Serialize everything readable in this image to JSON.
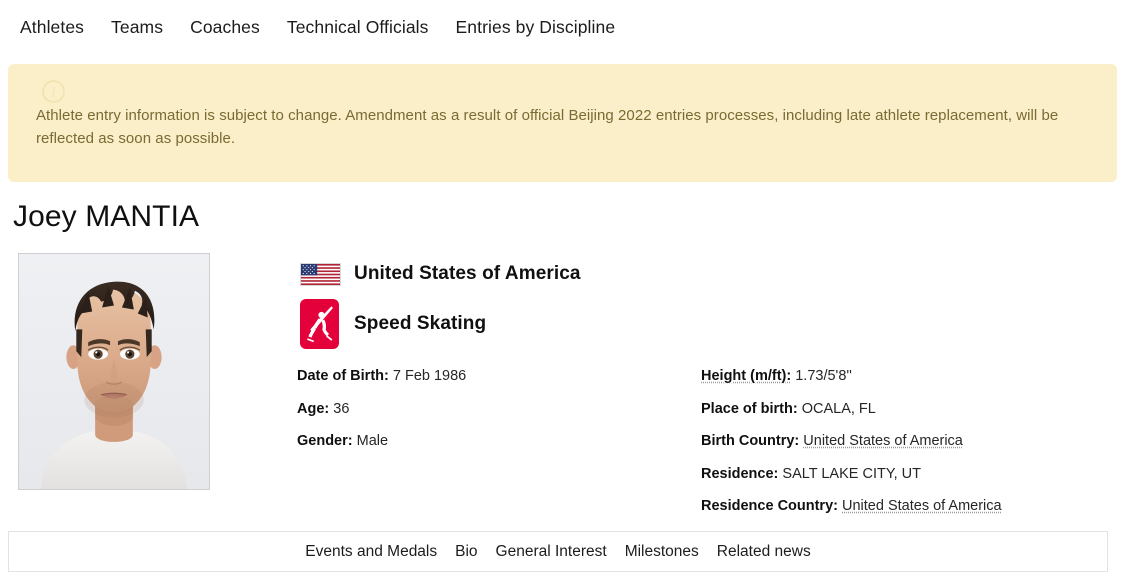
{
  "topnav": {
    "items": [
      {
        "label": "Athletes"
      },
      {
        "label": "Teams"
      },
      {
        "label": "Coaches"
      },
      {
        "label": "Technical Officials"
      },
      {
        "label": "Entries by Discipline"
      }
    ]
  },
  "notice": {
    "icon": "info-icon",
    "icon_glyph": "i",
    "text": "Athlete entry information is subject to change. Amendment as a result of official Beijing 2022 entries processes, including late athlete replacement, will be reflected as soon as possible.",
    "background_color": "#faefc9",
    "text_color": "#7a6a33"
  },
  "athlete": {
    "name": "Joey MANTIA",
    "photo_alt": "athlete-portrait",
    "country": "United States of America",
    "country_flag": "flag-usa",
    "sport": "Speed Skating",
    "sport_icon": "speed-skating-pictogram",
    "sport_icon_color": "#e4003a",
    "details_left": [
      {
        "label": "Date of Birth:",
        "value": "7 Feb 1986"
      },
      {
        "label": "Age:",
        "value": "36"
      },
      {
        "label": "Gender:",
        "value": "Male"
      }
    ],
    "details_right": [
      {
        "label": "Height (m/ft):",
        "value": "1.73/5'8''"
      },
      {
        "label": "Place of birth:",
        "value": "OCALA, FL"
      },
      {
        "label": "Birth Country:",
        "value": "United States of America"
      },
      {
        "label": "Residence:",
        "value": "SALT LAKE CITY, UT"
      },
      {
        "label": "Residence Country:",
        "value": "United States of America"
      }
    ]
  },
  "tabbar": {
    "items": [
      {
        "label": "Events and Medals"
      },
      {
        "label": "Bio"
      },
      {
        "label": "General Interest"
      },
      {
        "label": "Milestones"
      },
      {
        "label": "Related news"
      }
    ]
  }
}
